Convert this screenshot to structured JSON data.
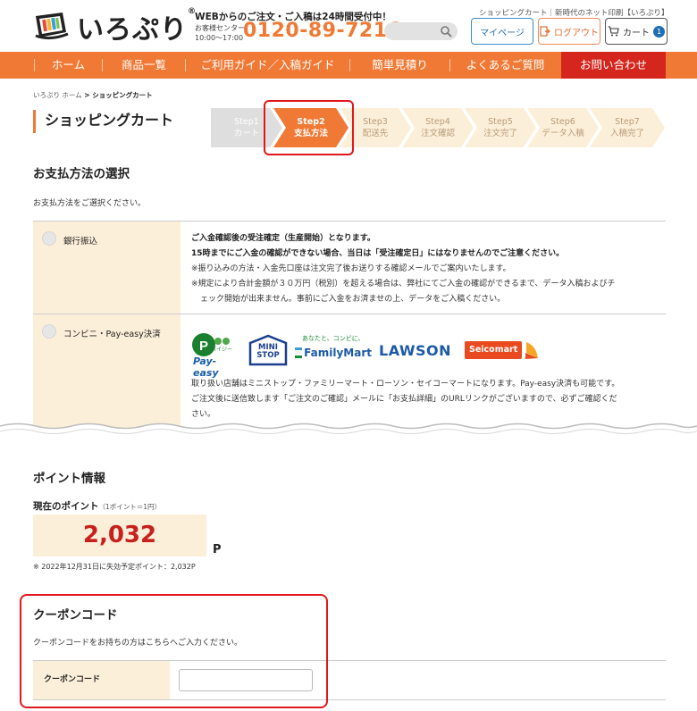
{
  "header": {
    "logo_text": "いろぷり",
    "logo_reg": "®",
    "tagline": "WEBからのご注文・ご入稿は24時間受付中！",
    "center_label": "お客様センター",
    "center_hours": "10:00〜17:00",
    "phone": "0120-89-7216",
    "top_links": "ショッピングカート｜新時代のネット印刷【いろぷり】",
    "mypage_label": "マイページ",
    "logout_label": "ログアウト",
    "cart_label": "カート",
    "cart_count": "1"
  },
  "nav": {
    "items": [
      "ホーム",
      "商品一覧",
      "ご利用ガイド／入稿ガイド",
      "簡単見積り",
      "よくあるご質問"
    ],
    "contact": "お問い合わせ"
  },
  "breadcrumb": {
    "home": "いろぷり ホーム",
    "sep": " > ",
    "current": "ショッピングカート"
  },
  "page_title": "ショッピングカート",
  "steps": [
    {
      "num": "Step1",
      "label": "カート",
      "state": "done"
    },
    {
      "num": "Step2",
      "label": "支払方法",
      "state": "active"
    },
    {
      "num": "Step3",
      "label": "配送先",
      "state": "todo"
    },
    {
      "num": "Step4",
      "label": "注文確認",
      "state": "todo"
    },
    {
      "num": "Step5",
      "label": "注文完了",
      "state": "todo"
    },
    {
      "num": "Step6",
      "label": "データ入稿",
      "state": "todo"
    },
    {
      "num": "Step7",
      "label": "入稿完了",
      "state": "todo"
    }
  ],
  "payment": {
    "title": "お支払方法の選択",
    "desc": "お支払方法をご選択ください。",
    "bank": {
      "label": "銀行振込",
      "line1": "ご入金確認後の受注確定（生産開始）となります。",
      "line2": "15時までにご入金の確認ができない場合、当日は「受注確定日」にはなりませんのでご注意ください。",
      "line3": "※振り込みの方法・入金先口座は注文完了後お送りする確認メールでご案内いたします。",
      "line4": "※規定により合計金額が３０万円（税別）を超える場合は、弊社にてご入金の確認ができるまで、データ入稿およびチ",
      "line5": "ェック開始が出来ません。事前にご入金をお済ませの上、データをご入稿ください。"
    },
    "conv": {
      "label": "コンビニ・Pay-easy決済",
      "brand_payeasy": "Pay-easy",
      "brand_payeasy_sub": "ペイジー",
      "brand_ministop": "MINI STOP",
      "brand_famima_tag": "あなたと、コンビに、",
      "brand_famima": "FamilyMart",
      "brand_lawson": "LAWSON",
      "brand_seicomart": "Seicomart",
      "text1": "取り扱い店舗はミニストップ・ファミリーマート・ローソン・セイコーマートになります。Pay-easy決済も可能です。",
      "text2": "ご注文後に送信致します「ご注文のご確認」メールに「お支払詳細」のURLリンクがございますので、必ずご確認くだ",
      "text3": "さい。"
    }
  },
  "points": {
    "title": "ポイント情報",
    "current_label": "現在のポイント",
    "rate": "（1ポイント＝1円）",
    "value": "2,032",
    "unit": "P",
    "expiry_note": "※ 2022年12月31日に失効予定ポイント：2,032P"
  },
  "coupon": {
    "title": "クーポンコード",
    "desc": "クーポンコードをお持ちの方はこちらへご入力ください。",
    "field_label": "クーポンコード",
    "placeholder": ""
  },
  "colors": {
    "brand": "#f07a35",
    "contact": "#d4261d",
    "highlight": "#e0181d",
    "label_bg": "#fcefd9"
  }
}
